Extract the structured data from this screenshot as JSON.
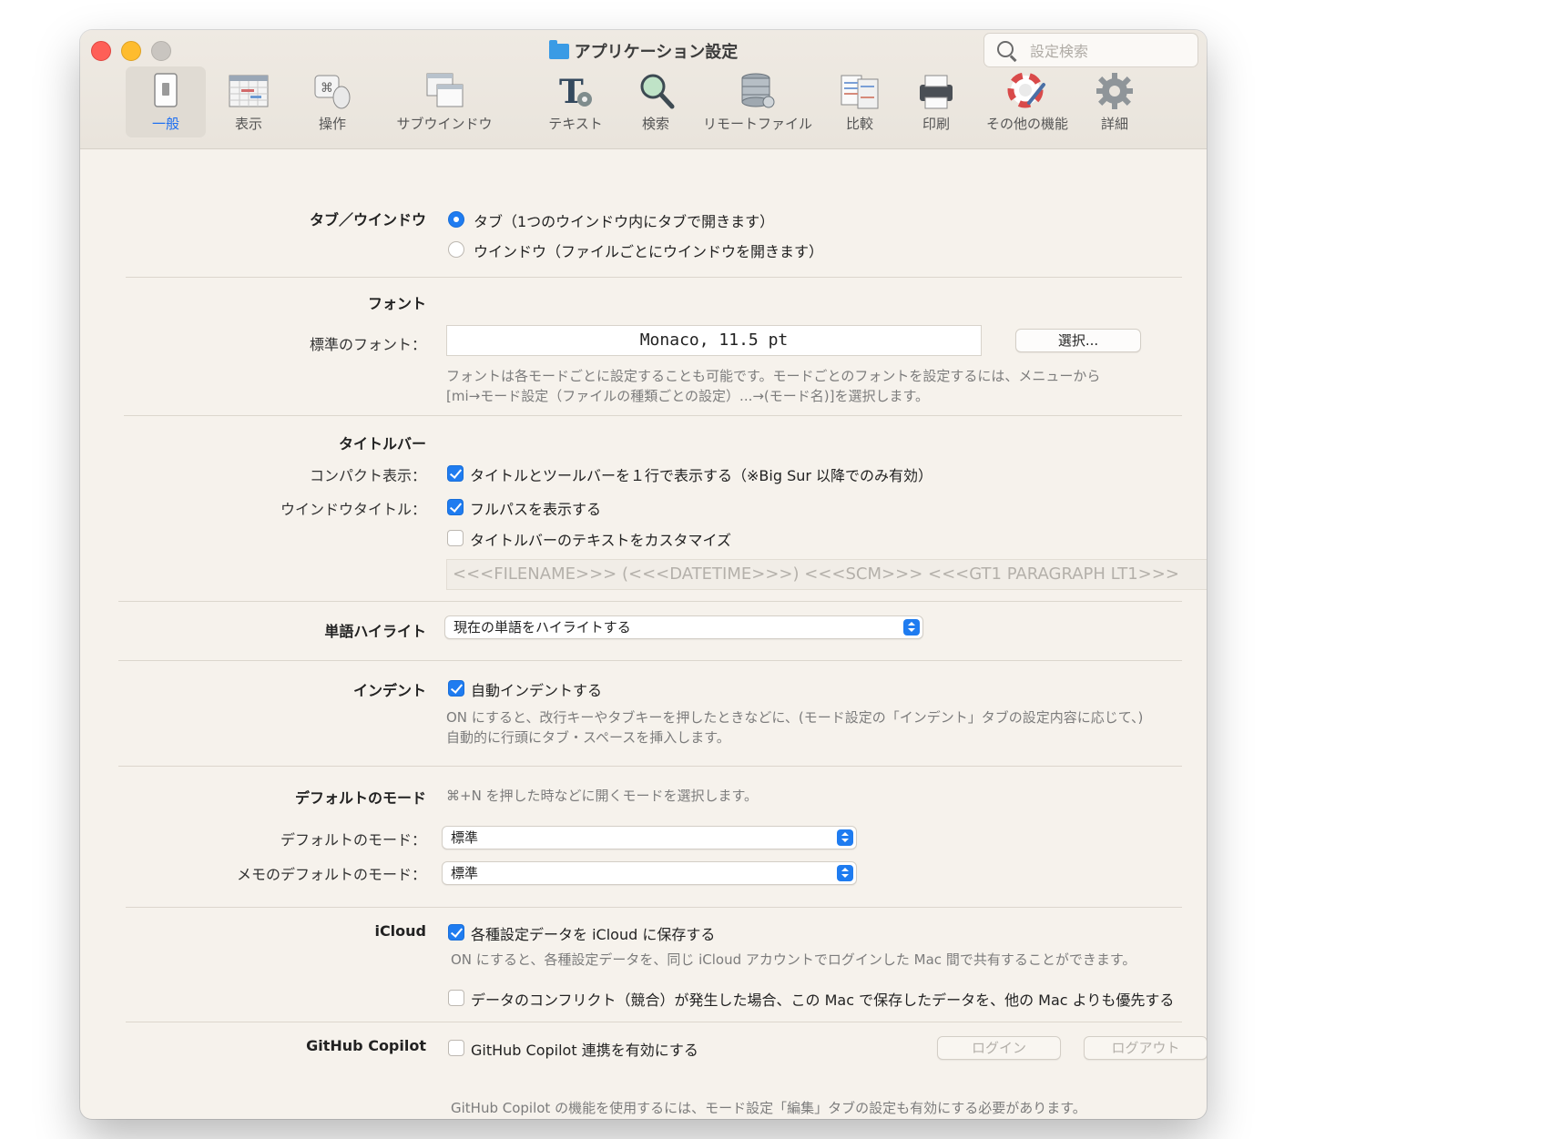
{
  "window": {
    "title": "アプリケーション設定"
  },
  "search": {
    "placeholder": "設定検索"
  },
  "toolbar": {
    "items": [
      {
        "label": "一般"
      },
      {
        "label": "表示"
      },
      {
        "label": "操作"
      },
      {
        "label": "サブウインドウ"
      },
      {
        "label": "テキスト"
      },
      {
        "label": "検索"
      },
      {
        "label": "リモートファイル"
      },
      {
        "label": "比較"
      },
      {
        "label": "印刷"
      },
      {
        "label": "その他の機能"
      },
      {
        "label": "詳細"
      }
    ],
    "selected": "一般"
  },
  "help": {
    "label": "?"
  },
  "tab_window": {
    "label": "タブ／ウインドウ",
    "option_tab": "タブ（1つのウインドウ内にタブで開きます）",
    "option_window": "ウインドウ（ファイルごとにウインドウを開きます）"
  },
  "font": {
    "label": "フォント",
    "standard_label": "標準のフォント：",
    "value": "Monaco, 11.5 pt",
    "select_button": "選択...",
    "note_line1": "フォントは各モードごとに設定することも可能です。モードごとのフォントを設定するには、メニューから",
    "note_line2": "[mi→モード設定（ファイルの種類ごとの設定）...→(モード名)]を選択します。"
  },
  "titlebar": {
    "label": "タイトルバー",
    "compact_label": "コンパクト表示：",
    "compact_option": "タイトルとツールバーを１行で表示する（※Big Sur 以降でのみ有効）",
    "window_title_label": "ウインドウタイトル：",
    "fullpath_option": "フルパスを表示する",
    "customize_option": "タイトルバーのテキストをカスタマイズ",
    "template": "<<<FILENAME>>> (<<<DATETIME>>>)  <<<SCM>>> <<<GT1 PARAGRAPH LT1>>>"
  },
  "word_highlight": {
    "label": "単語ハイライト",
    "value": "現在の単語をハイライトする"
  },
  "indent": {
    "label": "インデント",
    "option": "自動インデントする",
    "note_line1": "ON にすると、改行キーやタブキーを押したときなどに、(モード設定の「インデント」タブの設定内容に応じて、)",
    "note_line2": "自動的に行頭にタブ・スペースを挿入します。"
  },
  "default_mode": {
    "label": "デフォルトのモード",
    "note": "⌘+N を押した時などに開くモードを選択します。",
    "mode_label": "デフォルトのモード：",
    "mode_value": "標準",
    "memo_label": "メモのデフォルトのモード：",
    "memo_value": "標準"
  },
  "icloud": {
    "label": "iCloud",
    "save_option": "各種設定データを iCloud に保存する",
    "note": "ON にすると、各種設定データを、同じ iCloud アカウントでログインした Mac 間で共有することができます。",
    "conflict_option": "データのコンフリクト（競合）が発生した場合、この Mac で保存したデータを、他の Mac よりも優先する"
  },
  "copilot": {
    "label": "GitHub Copilot",
    "option": "GitHub Copilot 連携を有効にする",
    "login": "ログイン",
    "logout": "ログアウト",
    "note": "GitHub Copilot の機能を使用するには、モード設定「編集」タブの設定も有効にする必要があります。"
  },
  "colors": {
    "accent": "#1f7cf0",
    "window_bg": "#f6f2ec",
    "close": "#fe5f57",
    "minimize": "#febc2e"
  }
}
